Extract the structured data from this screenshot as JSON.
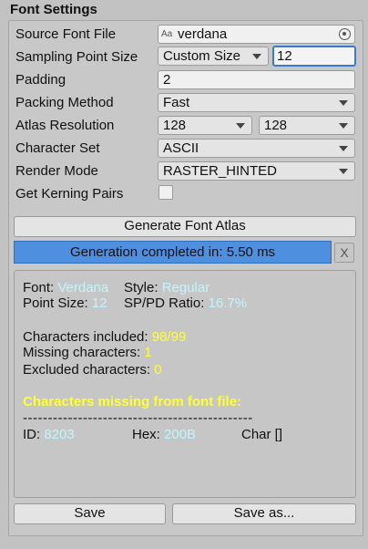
{
  "header": {
    "title": "Font Settings"
  },
  "form": {
    "source_font_label": "Source Font File",
    "source_font_icon": "Aa",
    "source_font_value": "verdana",
    "sampling_label": "Sampling Point Size",
    "sampling_mode": "Custom Size",
    "sampling_value": "12",
    "padding_label": "Padding",
    "padding_value": "2",
    "packing_label": "Packing Method",
    "packing_value": "Fast",
    "atlas_label": "Atlas Resolution",
    "atlas_width": "128",
    "atlas_height": "128",
    "charset_label": "Character Set",
    "charset_value": "ASCII",
    "render_label": "Render Mode",
    "render_value": "RASTER_HINTED",
    "kerning_label": "Get Kerning Pairs"
  },
  "actions": {
    "generate_label": "Generate Font Atlas",
    "progress_text": "Generation completed in: 5.50 ms",
    "progress_fraction": 1.0,
    "close_label": "X",
    "save_label": "Save",
    "save_as_label": "Save as..."
  },
  "report": {
    "font_label": "Font:",
    "font_value": "Verdana",
    "style_label": "Style:",
    "style_value": "Regular",
    "point_size_label": "Point Size:",
    "point_size_value": "12",
    "ratio_label": "SP/PD Ratio:",
    "ratio_value": "16.7%",
    "included_label": "Characters included:",
    "included_value": "98/99",
    "missing_label": "Missing characters:",
    "missing_value": "1",
    "excluded_label": "Excluded characters:",
    "excluded_value": "0",
    "missing_header": "Characters missing from font file:",
    "separator": "----------------------------------------------",
    "id_label": "ID:",
    "id_value": "8203",
    "hex_label": "Hex:",
    "hex_value": "200B",
    "char_label": "Char []"
  },
  "colors": {
    "background": "#c2c2c2",
    "progress_fill": "#4f8fe0",
    "value_cyan": "#bff6ff",
    "value_yellow": "#ffff33",
    "focus_border": "#3a7bd0"
  }
}
